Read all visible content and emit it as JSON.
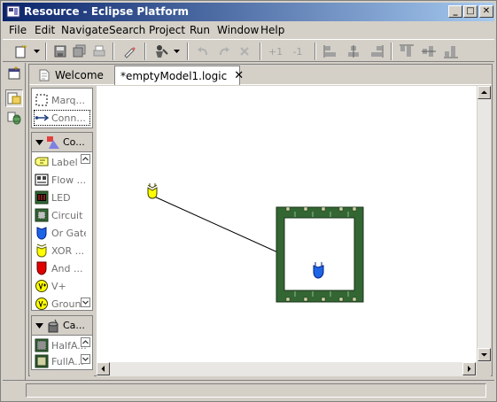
{
  "window": {
    "title": "Resource - Eclipse Platform",
    "controls": [
      "_",
      "□",
      "✕"
    ]
  },
  "menubar": {
    "items": [
      "File",
      "Edit",
      "Navigate",
      "Search",
      "Project",
      "Run",
      "Window",
      "Help"
    ]
  },
  "toolbar": {
    "plus_one": "+1",
    "minus_one": "-1"
  },
  "tabs": [
    {
      "label": "Welcome",
      "icon": "document-icon",
      "active": false
    },
    {
      "label": "*emptyModel1.logic",
      "icon": "or-gate-icon",
      "active": true,
      "close": "✕"
    }
  ],
  "palette": {
    "tools": [
      {
        "label": "Marq...",
        "icon": "marquee-icon"
      },
      {
        "label": "Conn...",
        "icon": "connection-icon"
      }
    ],
    "components_group": {
      "label": "Co...",
      "items": [
        {
          "label": "Label",
          "icon": "label-icon"
        },
        {
          "label": "Flow ...",
          "icon": "flow-container-icon"
        },
        {
          "label": "LED",
          "icon": "led-icon"
        },
        {
          "label": "Circuit",
          "icon": "circuit-icon"
        },
        {
          "label": "Or Gate",
          "icon": "or-gate-icon"
        },
        {
          "label": "XOR ...",
          "icon": "xor-gate-icon"
        },
        {
          "label": "And ...",
          "icon": "and-gate-icon"
        },
        {
          "label": "V+",
          "icon": "v-plus-icon"
        },
        {
          "label": "Ground",
          "icon": "ground-icon"
        }
      ]
    },
    "canned_group": {
      "label": "Ca...",
      "items": [
        {
          "label": "HalfA...",
          "icon": "half-adder-icon"
        },
        {
          "label": "FullA...",
          "icon": "full-adder-icon"
        }
      ]
    }
  },
  "colors": {
    "titlebar_start": "#0a246a",
    "titlebar_end": "#a6caf0",
    "circuit_green": "#336633",
    "or_gate_blue": "#1e64e6",
    "xor_gate_yellow": "#ffff00",
    "and_gate_red": "#e00000"
  }
}
